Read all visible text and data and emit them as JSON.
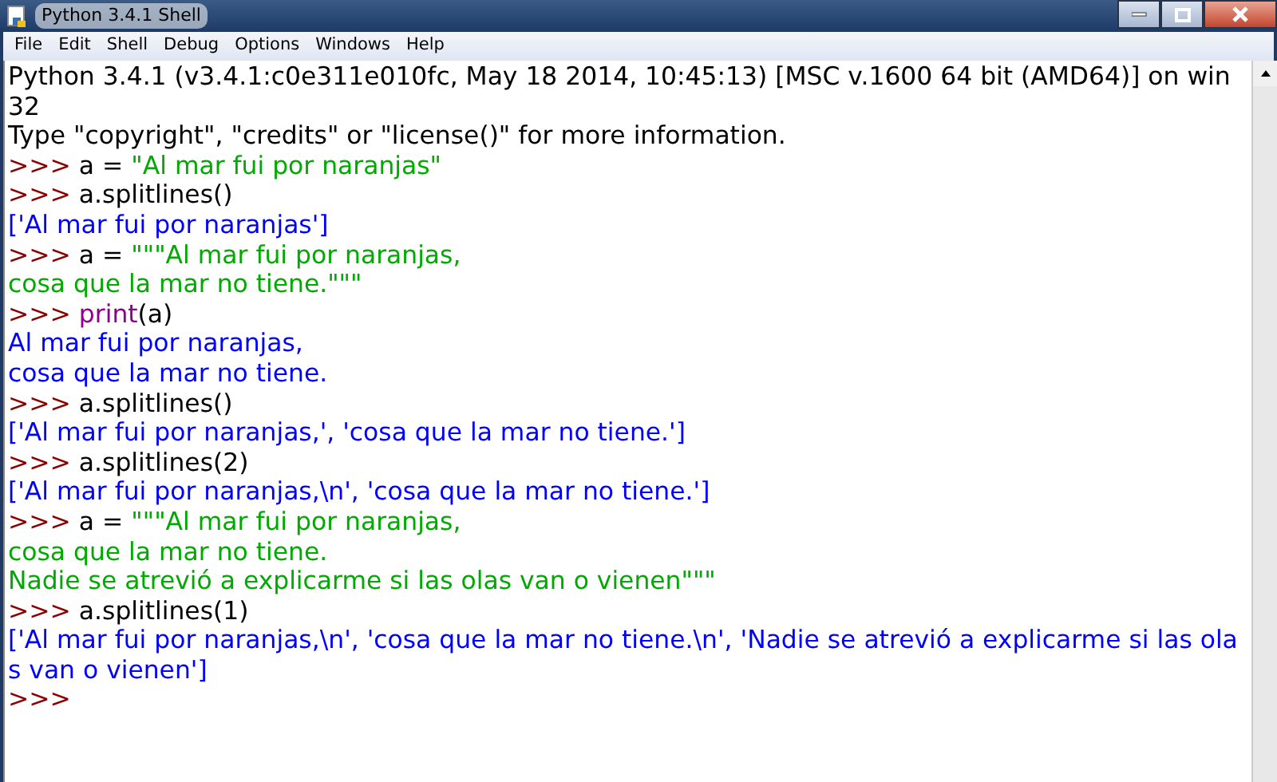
{
  "window": {
    "title": "Python 3.4.1 Shell"
  },
  "menu": [
    "File",
    "Edit",
    "Shell",
    "Debug",
    "Options",
    "Windows",
    "Help"
  ],
  "lines": [
    [
      {
        "kind": "plain",
        "text": "Python 3.4.1 (v3.4.1:c0e311e010fc, May 18 2014, 10:45:13) [MSC v.1600 64 bit (AMD64)] on win"
      }
    ],
    [
      {
        "kind": "plain",
        "text": "32"
      }
    ],
    [
      {
        "kind": "plain",
        "text": "Type \"copyright\", \"credits\" or \"license()\" for more information."
      }
    ],
    [
      {
        "kind": "prompt",
        "text": ">>> "
      },
      {
        "kind": "code",
        "text": "a = "
      },
      {
        "kind": "string",
        "text": "\"Al mar fui por naranjas\""
      }
    ],
    [
      {
        "kind": "prompt",
        "text": ">>> "
      },
      {
        "kind": "code",
        "text": "a.splitlines()"
      }
    ],
    [
      {
        "kind": "output",
        "text": "['Al mar fui por naranjas']"
      }
    ],
    [
      {
        "kind": "prompt",
        "text": ">>> "
      },
      {
        "kind": "code",
        "text": "a = "
      },
      {
        "kind": "string",
        "text": "\"\"\"Al mar fui por naranjas,"
      }
    ],
    [
      {
        "kind": "string",
        "text": "cosa que la mar no tiene.\"\"\""
      }
    ],
    [
      {
        "kind": "prompt",
        "text": ">>> "
      },
      {
        "kind": "builtin",
        "text": "print"
      },
      {
        "kind": "code",
        "text": "(a)"
      }
    ],
    [
      {
        "kind": "output",
        "text": "Al mar fui por naranjas,"
      }
    ],
    [
      {
        "kind": "output",
        "text": "cosa que la mar no tiene."
      }
    ],
    [
      {
        "kind": "prompt",
        "text": ">>> "
      },
      {
        "kind": "code",
        "text": "a.splitlines()"
      }
    ],
    [
      {
        "kind": "output",
        "text": "['Al mar fui por naranjas,', 'cosa que la mar no tiene.']"
      }
    ],
    [
      {
        "kind": "prompt",
        "text": ">>> "
      },
      {
        "kind": "code",
        "text": "a.splitlines(2)"
      }
    ],
    [
      {
        "kind": "output",
        "text": "['Al mar fui por naranjas,\\n', 'cosa que la mar no tiene.']"
      }
    ],
    [
      {
        "kind": "prompt",
        "text": ">>> "
      },
      {
        "kind": "code",
        "text": "a = "
      },
      {
        "kind": "string",
        "text": "\"\"\"Al mar fui por naranjas,"
      }
    ],
    [
      {
        "kind": "string",
        "text": "cosa que la mar no tiene."
      }
    ],
    [
      {
        "kind": "string",
        "text": "Nadie se atrevió a explicarme si las olas van o vienen\"\"\""
      }
    ],
    [
      {
        "kind": "prompt",
        "text": ">>> "
      },
      {
        "kind": "code",
        "text": "a.splitlines(1)"
      }
    ],
    [
      {
        "kind": "output",
        "text": "['Al mar fui por naranjas,\\n', 'cosa que la mar no tiene.\\n', 'Nadie se atrevió a explicarme si las ola"
      }
    ],
    [
      {
        "kind": "output",
        "text": "s van o vienen']"
      }
    ],
    [
      {
        "kind": "prompt",
        "text": ">>>"
      }
    ]
  ]
}
